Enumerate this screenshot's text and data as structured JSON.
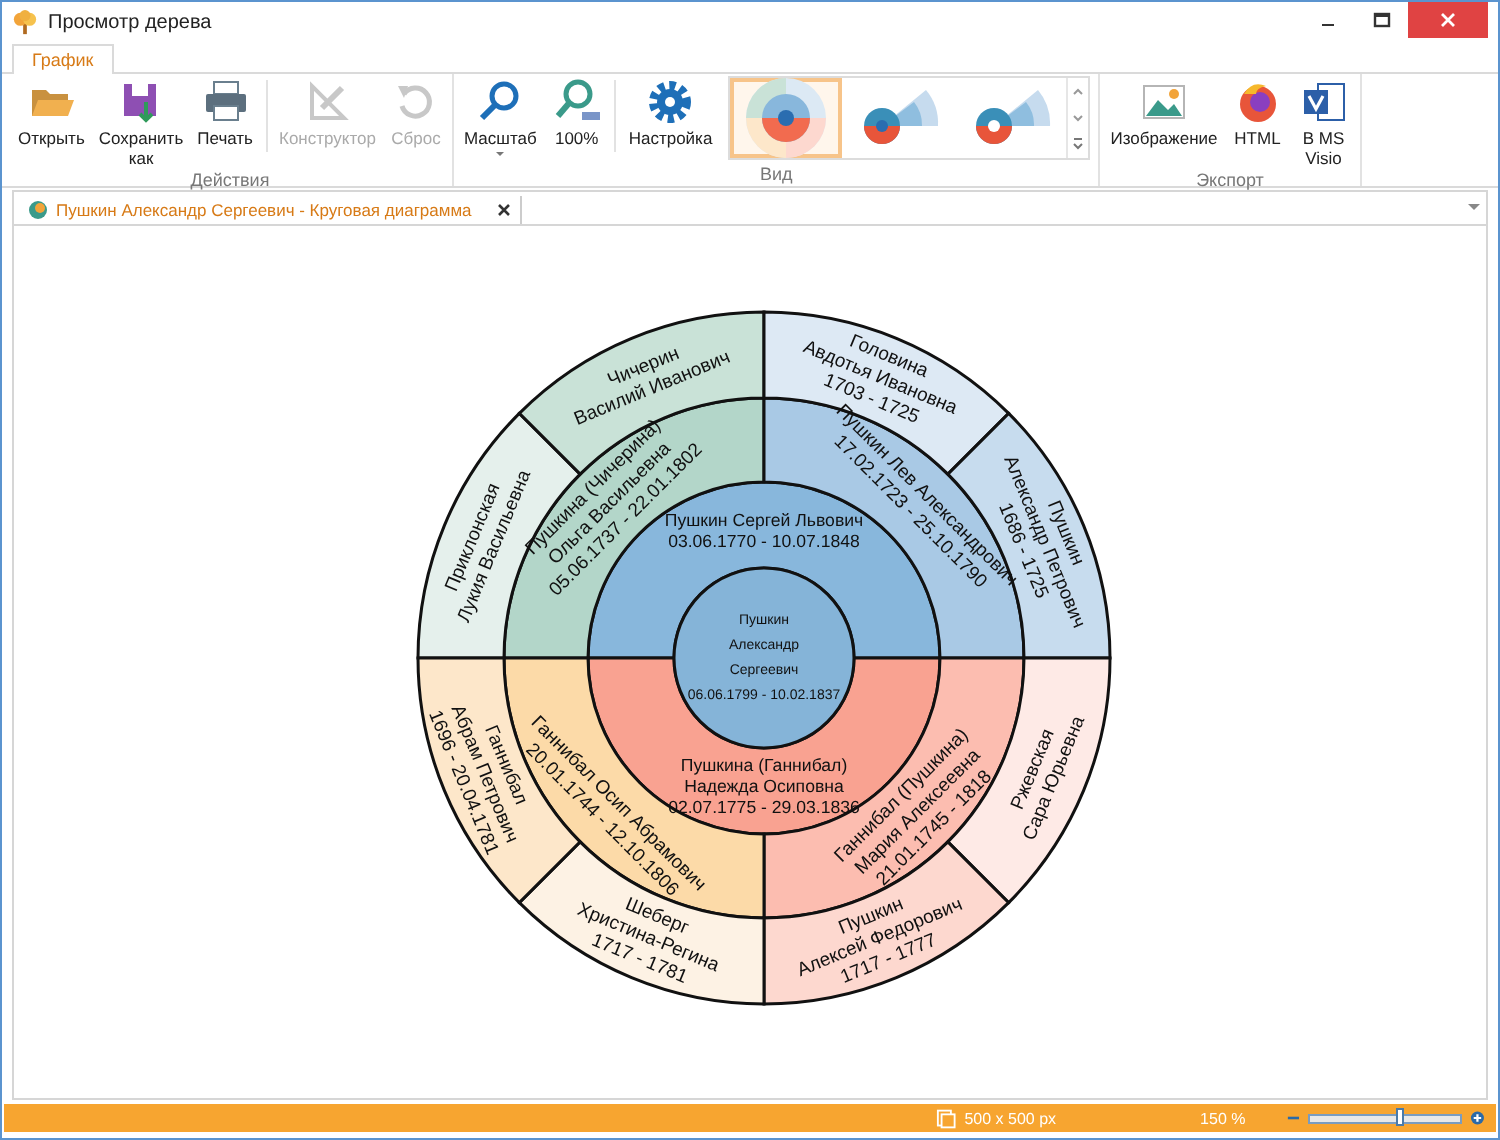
{
  "window": {
    "title": "Просмотр дерева"
  },
  "ribbon": {
    "tabs": [
      {
        "label": "График",
        "selected": true
      }
    ],
    "groups": [
      {
        "label": "Действия",
        "items": [
          {
            "kind": "button",
            "label": "Открыть",
            "disabled": false
          },
          {
            "kind": "button",
            "label": "Сохранить\nкак",
            "disabled": false
          },
          {
            "kind": "button",
            "label": "Печать",
            "disabled": false
          },
          {
            "kind": "separator"
          },
          {
            "kind": "button",
            "label": "Конструктор",
            "disabled": true
          },
          {
            "kind": "button",
            "label": "Сброс",
            "disabled": true
          }
        ]
      },
      {
        "label": "Вид",
        "items": [
          {
            "kind": "button",
            "label": "Масштаб",
            "disabled": false,
            "has_menu": true
          },
          {
            "kind": "button",
            "label": "100%",
            "disabled": false
          },
          {
            "kind": "separator"
          },
          {
            "kind": "button",
            "label": "Настройка",
            "disabled": false
          },
          {
            "kind": "gallery",
            "items": [
              {
                "selected": true
              },
              {
                "selected": false
              },
              {
                "selected": false
              }
            ]
          }
        ]
      },
      {
        "label": "Экспорт",
        "items": [
          {
            "kind": "button",
            "label": "Изображение",
            "disabled": false
          },
          {
            "kind": "button",
            "label": "HTML",
            "disabled": false
          },
          {
            "kind": "button",
            "label": "В MS\nVisio",
            "disabled": false
          }
        ]
      }
    ]
  },
  "document_tabs": [
    {
      "label": "Пушкин Александр Сергеевич - Круговая диаграмма",
      "selected": true
    }
  ],
  "chart": {
    "center": {
      "lines": [
        "Пушкин",
        "Александр",
        "Сергеевич",
        "06.06.1799 - 10.02.1837"
      ],
      "color": "#85b4d8"
    },
    "rings": [
      {
        "sectors": [
          {
            "lines": [
              "Пушкин Сергей Львович",
              "03.06.1770 - 10.07.1848"
            ],
            "color": "#88b7dc"
          },
          {
            "lines": [
              "Пушкина (Ганнибал)",
              "Надежда Осиповна",
              "02.07.1775 - 29.03.1836"
            ],
            "color": "#f9a291"
          }
        ]
      },
      {
        "sectors": [
          {
            "lines": [
              "Пушкина (Чичерина)",
              "Ольга Васильевна",
              "05.06.1737 - 22.01.1802"
            ],
            "color": "#b3d6c9"
          },
          {
            "lines": [
              "Пушкин Лев Александрович",
              "17.02.1723 - 25.10.1790"
            ],
            "color": "#a9c9e5"
          },
          {
            "lines": [
              "Ганнибал (Пушкина)",
              "Мария Алексеевна",
              "21.01.1745 - 1818"
            ],
            "color": "#fcbdb0"
          },
          {
            "lines": [
              "Ганнибал Осип Абрамович",
              "20.01.1744 - 12.10.1806"
            ],
            "color": "#fcdaa8"
          }
        ]
      },
      {
        "sectors": [
          {
            "lines": [
              "Приклонская",
              "Лукия Васильевна"
            ],
            "color": "#e5f0ec"
          },
          {
            "lines": [
              "Чичерин",
              "Василий Иванович"
            ],
            "color": "#c9e2d7"
          },
          {
            "lines": [
              "Головина",
              "Авдотья Ивановна",
              "1703 - 1725"
            ],
            "color": "#dde9f4"
          },
          {
            "lines": [
              "Пушкин",
              "Александр Петрович",
              "1686 - 1725"
            ],
            "color": "#c7dcee"
          },
          {
            "lines": [
              "Ржевская",
              "Сара Юрьевна"
            ],
            "color": "#feeae6"
          },
          {
            "lines": [
              "Пушкин",
              "Алексей Федорович",
              "1717 - 1777"
            ],
            "color": "#fdd8cf"
          },
          {
            "lines": [
              "Шеберг",
              "Христина-Регина",
              "1717 - 1781"
            ],
            "color": "#fdf2e4"
          },
          {
            "lines": [
              "Ганнибал",
              "Абрам Петрович",
              "1696 - 20.04.1781"
            ],
            "color": "#fde7ca"
          }
        ]
      }
    ]
  },
  "status_bar": {
    "size": "500 x 500 px",
    "zoom": "150 %",
    "zoom_slider": {
      "level": 0.6
    }
  }
}
